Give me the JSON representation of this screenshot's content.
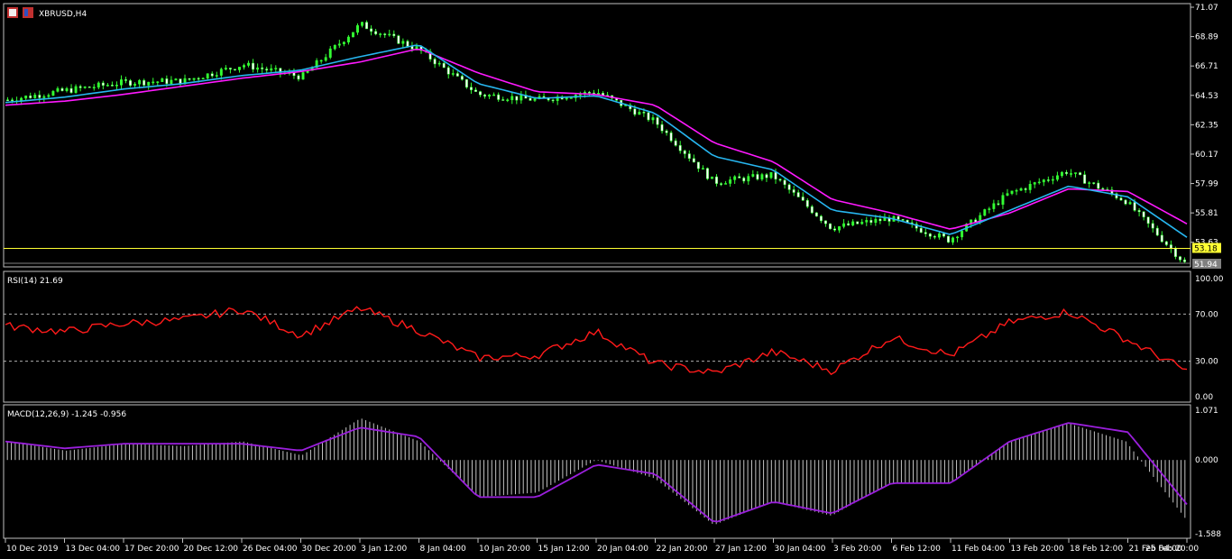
{
  "window": {
    "title": "XBRUSD,H4"
  },
  "colors": {
    "background": "#000000",
    "frame": "#c0c0c0",
    "bull": "#33ff33",
    "bear": "#ffffff",
    "ma_fast": "#27b6f0",
    "ma_slow": "#ff19ff",
    "rsi": "#ff1a1a",
    "macd_signal": "#9a1fdc",
    "macd_hist": "#c4c4c4",
    "hline": "#ffff33",
    "grid_dash": "#c8c8c8",
    "price_label_bg": "#ffff33",
    "price_label_text": "#000000",
    "last_label_bg": "#808080"
  },
  "price_axis": {
    "ticks": [
      "71.07",
      "68.89",
      "66.71",
      "64.53",
      "62.35",
      "60.17",
      "57.99",
      "55.81",
      "53.63"
    ]
  },
  "price_labels": {
    "level_line": "53.18",
    "last": "51.94"
  },
  "rsi": {
    "title": "RSI(14) 21.69",
    "axis_ticks": [
      "100.00",
      "70.00",
      "30.00",
      "0.00"
    ]
  },
  "macd": {
    "title": "MACD(12,26,9) -1.245 -0.956",
    "axis_ticks": [
      "1.071",
      "0.000",
      "-1.588"
    ]
  },
  "time_axis": [
    "10 Dec 2019",
    "13 Dec 04:00",
    "17 Dec 20:00",
    "20 Dec 12:00",
    "26 Dec 04:00",
    "30 Dec 20:00",
    "3 Jan 12:00",
    "8 Jan 04:00",
    "10 Jan 20:00",
    "15 Jan 12:00",
    "20 Jan 04:00",
    "22 Jan 20:00",
    "27 Jan 12:00",
    "30 Jan 04:00",
    "3 Feb 20:00",
    "6 Feb 12:00",
    "11 Feb 04:00",
    "13 Feb 20:00",
    "18 Feb 12:00",
    "21 Feb 04:00",
    "25 Feb 20:00"
  ],
  "chart_data": [
    {
      "type": "line",
      "title": "XBRUSD,H4",
      "ylim": [
        51.94,
        71.07
      ],
      "x": [
        "10 Dec 2019",
        "13 Dec 04:00",
        "17 Dec 20:00",
        "20 Dec 12:00",
        "26 Dec 04:00",
        "30 Dec 20:00",
        "3 Jan 12:00",
        "8 Jan 04:00",
        "10 Jan 20:00",
        "15 Jan 12:00",
        "20 Jan 04:00",
        "22 Jan 20:00",
        "27 Jan 12:00",
        "30 Jan 04:00",
        "3 Feb 20:00",
        "6 Feb 12:00",
        "11 Feb 04:00",
        "13 Feb 20:00",
        "18 Feb 12:00",
        "21 Feb 04:00",
        "25 Feb 20:00"
      ],
      "series": [
        {
          "values": [
            64.2,
            64.9,
            65.5,
            65.6,
            66.8,
            65.9,
            69.8,
            67.9,
            64.6,
            64.2,
            64.8,
            62.6,
            58.1,
            58.6,
            54.7,
            55.4,
            53.8,
            57.2,
            58.9,
            56.7,
            52.1
          ]
        },
        {
          "values": [
            64.0,
            64.4,
            65.0,
            65.4,
            66.0,
            66.4,
            67.4,
            68.3,
            65.4,
            64.3,
            64.5,
            63.2,
            60.0,
            59.0,
            56.0,
            55.4,
            54.2,
            56.0,
            57.8,
            57.0,
            54.0
          ]
        },
        {
          "values": [
            63.8,
            64.1,
            64.6,
            65.2,
            65.8,
            66.3,
            67.0,
            68.0,
            66.2,
            64.8,
            64.6,
            63.8,
            61.0,
            59.6,
            56.8,
            55.8,
            54.6,
            55.8,
            57.6,
            57.4,
            55.0
          ]
        }
      ],
      "hline": 53.18,
      "grid": false
    },
    {
      "type": "line",
      "title": "RSI(14) 21.69",
      "ylim": [
        0,
        100
      ],
      "levels": [
        70,
        30
      ],
      "x": [
        "10 Dec 2019",
        "13 Dec 04:00",
        "17 Dec 20:00",
        "20 Dec 12:00",
        "26 Dec 04:00",
        "30 Dec 20:00",
        "3 Jan 12:00",
        "8 Jan 04:00",
        "10 Jan 20:00",
        "15 Jan 12:00",
        "20 Jan 04:00",
        "22 Jan 20:00",
        "27 Jan 12:00",
        "30 Jan 04:00",
        "3 Feb 20:00",
        "6 Feb 12:00",
        "11 Feb 04:00",
        "13 Feb 20:00",
        "18 Feb 12:00",
        "21 Feb 04:00",
        "25 Feb 20:00"
      ],
      "series": [
        {
          "values": [
            60,
            55,
            62,
            65,
            74,
            52,
            75,
            56,
            33,
            35,
            55,
            28,
            20,
            38,
            22,
            50,
            35,
            63,
            72,
            48,
            21.69
          ]
        }
      ]
    },
    {
      "type": "bar",
      "title": "MACD(12,26,9) -1.245 -0.956",
      "ylim": [
        -1.588,
        1.071
      ],
      "x": [
        "10 Dec 2019",
        "13 Dec 04:00",
        "17 Dec 20:00",
        "20 Dec 12:00",
        "26 Dec 04:00",
        "30 Dec 20:00",
        "3 Jan 12:00",
        "8 Jan 04:00",
        "10 Jan 20:00",
        "15 Jan 12:00",
        "20 Jan 04:00",
        "22 Jan 20:00",
        "27 Jan 12:00",
        "30 Jan 04:00",
        "3 Feb 20:00",
        "6 Feb 12:00",
        "11 Feb 04:00",
        "13 Feb 20:00",
        "18 Feb 12:00",
        "21 Feb 04:00",
        "25 Feb 20:00"
      ],
      "series": [
        {
          "values": [
            0.4,
            0.2,
            0.35,
            0.3,
            0.4,
            0.1,
            0.9,
            0.4,
            -0.8,
            -0.7,
            0.0,
            -0.4,
            -1.4,
            -0.9,
            -1.2,
            -0.5,
            -0.5,
            0.4,
            0.8,
            0.4,
            -1.245
          ]
        },
        {
          "values": [
            0.4,
            0.25,
            0.35,
            0.35,
            0.35,
            0.2,
            0.7,
            0.5,
            -0.8,
            -0.8,
            -0.1,
            -0.3,
            -1.35,
            -0.9,
            -1.15,
            -0.5,
            -0.5,
            0.4,
            0.8,
            0.6,
            -0.956
          ]
        }
      ]
    }
  ]
}
